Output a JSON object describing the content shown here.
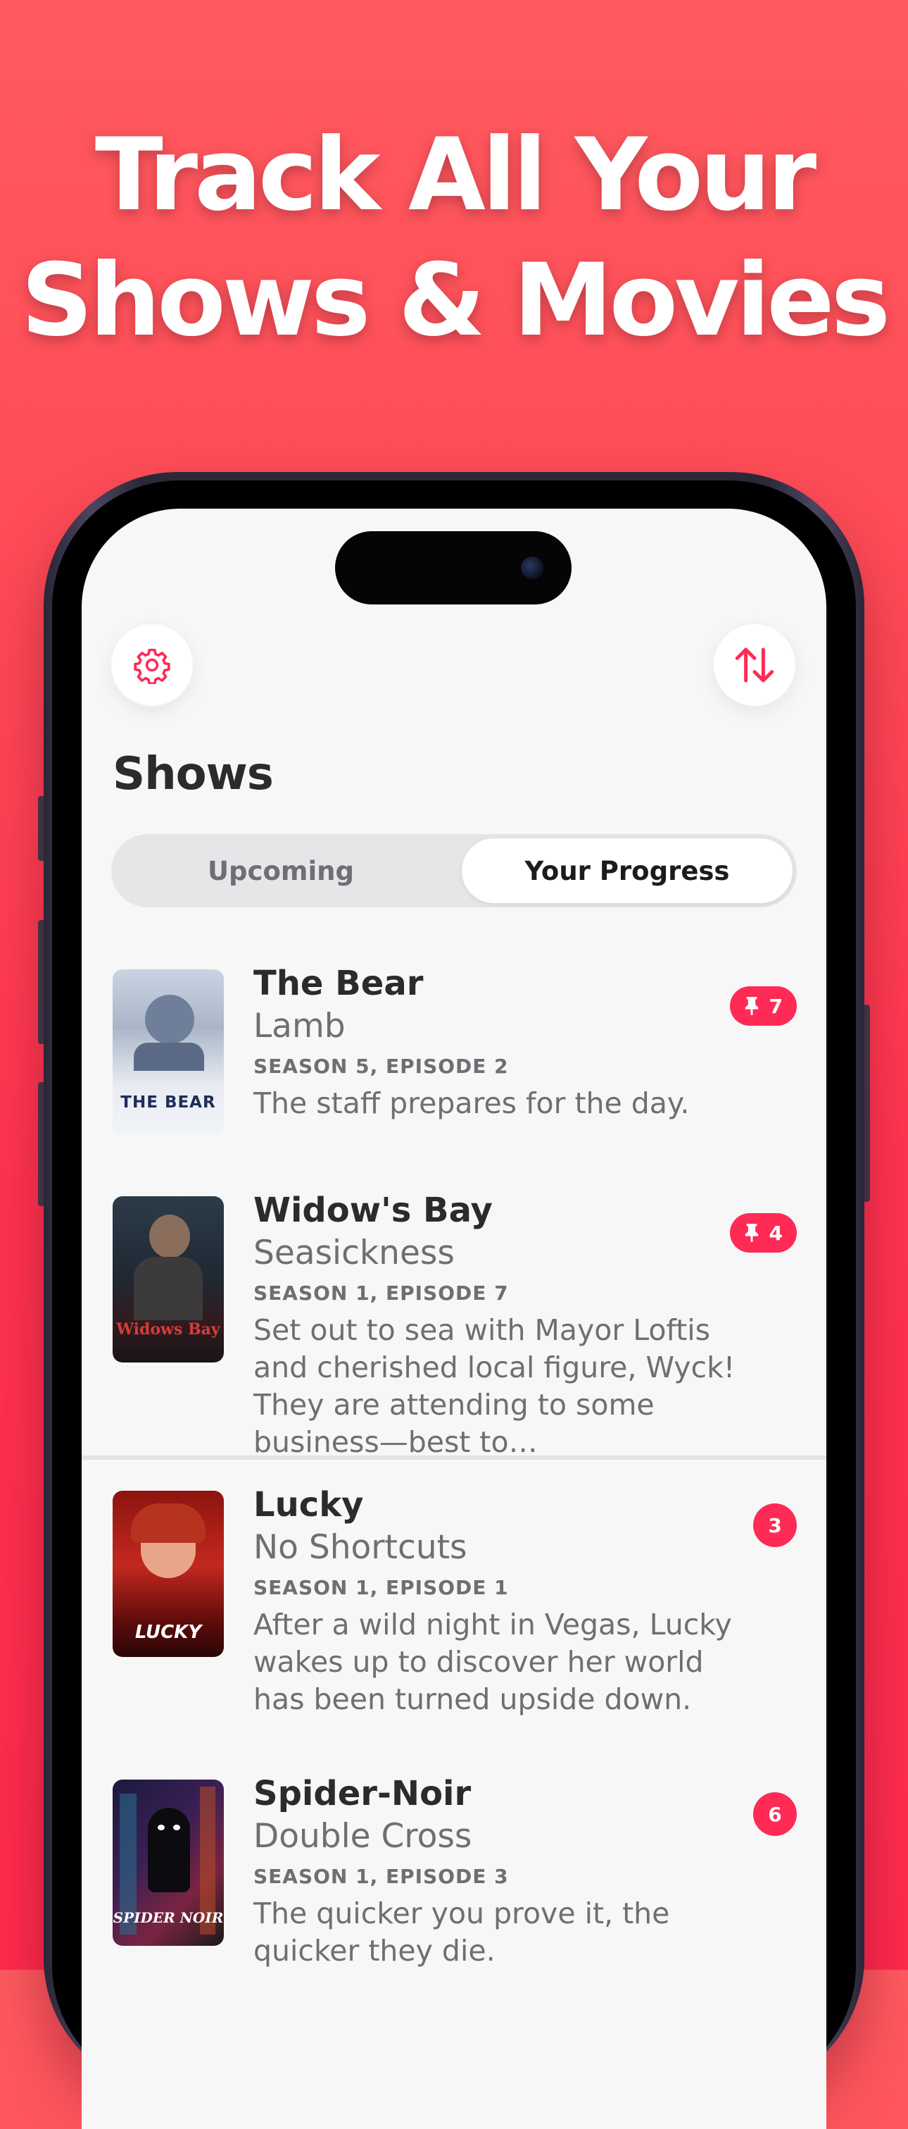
{
  "headline": {
    "line1": "Track All Your",
    "line2": "Shows & Movies"
  },
  "screen": {
    "title": "Shows",
    "settings_icon": "gear-icon",
    "sort_icon": "sort-arrows-icon",
    "segments": {
      "left": "Upcoming",
      "right": "Your Progress",
      "selected": "Your Progress"
    },
    "items": [
      {
        "title": "The Bear",
        "episode_title": "Lamb",
        "episode_number": "SEASON 5, EPISODE 2",
        "description": "The staff prepares for the day.",
        "badge": "7",
        "badge_icon": "pin-icon",
        "poster_text": "THE BEAR"
      },
      {
        "title": "Widow's Bay",
        "episode_title": "Seasickness",
        "episode_number": "SEASON 1, EPISODE 7",
        "description": "Set out to sea with Mayor Loftis and cherished local figure, Wyck! They are attending to some business—best to…",
        "badge": "4",
        "badge_icon": "pin-icon",
        "poster_text": "Widows Bay"
      },
      {
        "title": "Lucky",
        "episode_title": "No Shortcuts",
        "episode_number": "SEASON 1, EPISODE 1",
        "description": "After a wild night in Vegas, Lucky wakes up to discover her world has been turned upside down.",
        "badge": "3",
        "poster_text": "LUCKY"
      },
      {
        "title": "Spider-Noir",
        "episode_title": "Double Cross",
        "episode_number": "SEASON 1, EPISODE 3",
        "description": "The quicker you prove it, the quicker they die.",
        "badge": "6",
        "poster_text": "SPIDER NOIR"
      }
    ]
  },
  "colors": {
    "accent": "#ff2a55",
    "background": "#ff4a56"
  }
}
